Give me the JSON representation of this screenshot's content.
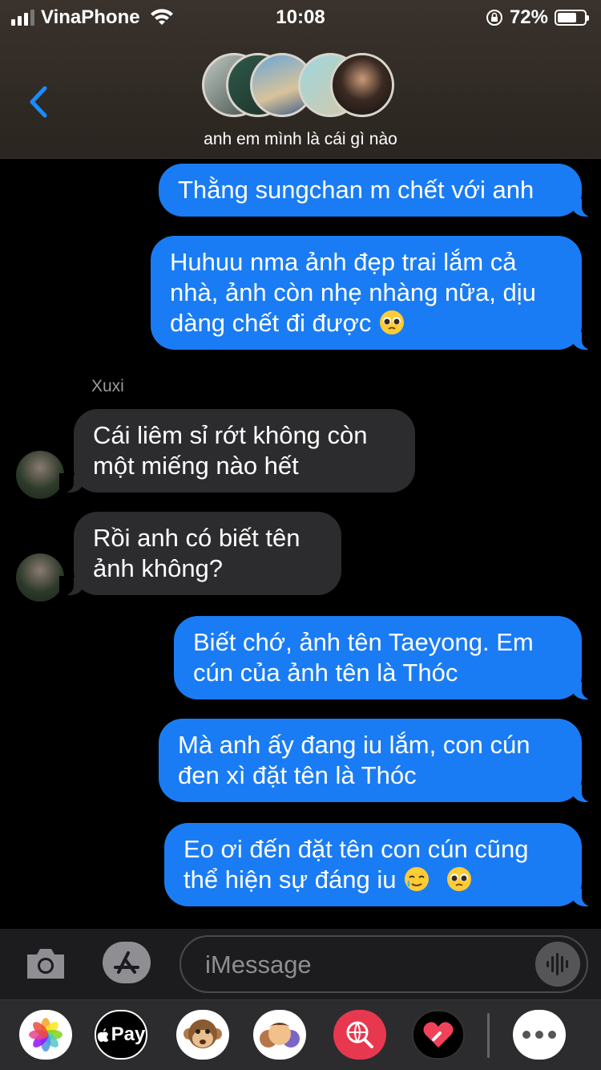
{
  "status_bar": {
    "carrier": "VinaPhone",
    "time": "10:08",
    "battery_percent": "72%",
    "battery_level": 0.72,
    "signal_bars": 3
  },
  "header": {
    "group_name": "anh em mình là cái gì nào",
    "back_icon": "chevron-left-icon"
  },
  "messages": [
    {
      "direction": "out",
      "text": "Thằng sungchan m chết với anh"
    },
    {
      "direction": "out",
      "text": "Huhuu nma ảnh đẹp trai lắm cả nhà, ảnh còn nhẹ nhàng nữa, dịu dàng chết đi được",
      "emoji": "pleading-face"
    },
    {
      "direction": "in",
      "sender": "Xuxi",
      "text": "Cái liêm sỉ rớt không còn một miếng nào hết"
    },
    {
      "direction": "in",
      "text": "Rồi anh có biết tên ảnh không?"
    },
    {
      "direction": "out",
      "text": "Biết chớ, ảnh tên Taeyong. Em cún của ảnh tên là Thóc"
    },
    {
      "direction": "out",
      "text": "Mà anh ấy đang iu lắm, con cún đen xì đặt tên là Thóc"
    },
    {
      "direction": "out",
      "text": "Eo ơi đến đặt tên con cún cũng thể hiện sự đáng iu",
      "emoji": [
        "smiling-face-with-tear",
        "pleading-face"
      ]
    }
  ],
  "input": {
    "placeholder": "iMessage",
    "value": ""
  },
  "app_drawer": {
    "apps": [
      "photos-icon",
      "apple-pay-icon",
      "monkey-animoji-icon",
      "memoji-icon",
      "web-images-icon",
      "digital-touch-icon",
      "more-icon"
    ],
    "apple_pay_label": "Pay"
  },
  "colors": {
    "outgoing_bubble": "#1a7cf4",
    "incoming_bubble": "#2c2c2e",
    "background": "#000000"
  }
}
